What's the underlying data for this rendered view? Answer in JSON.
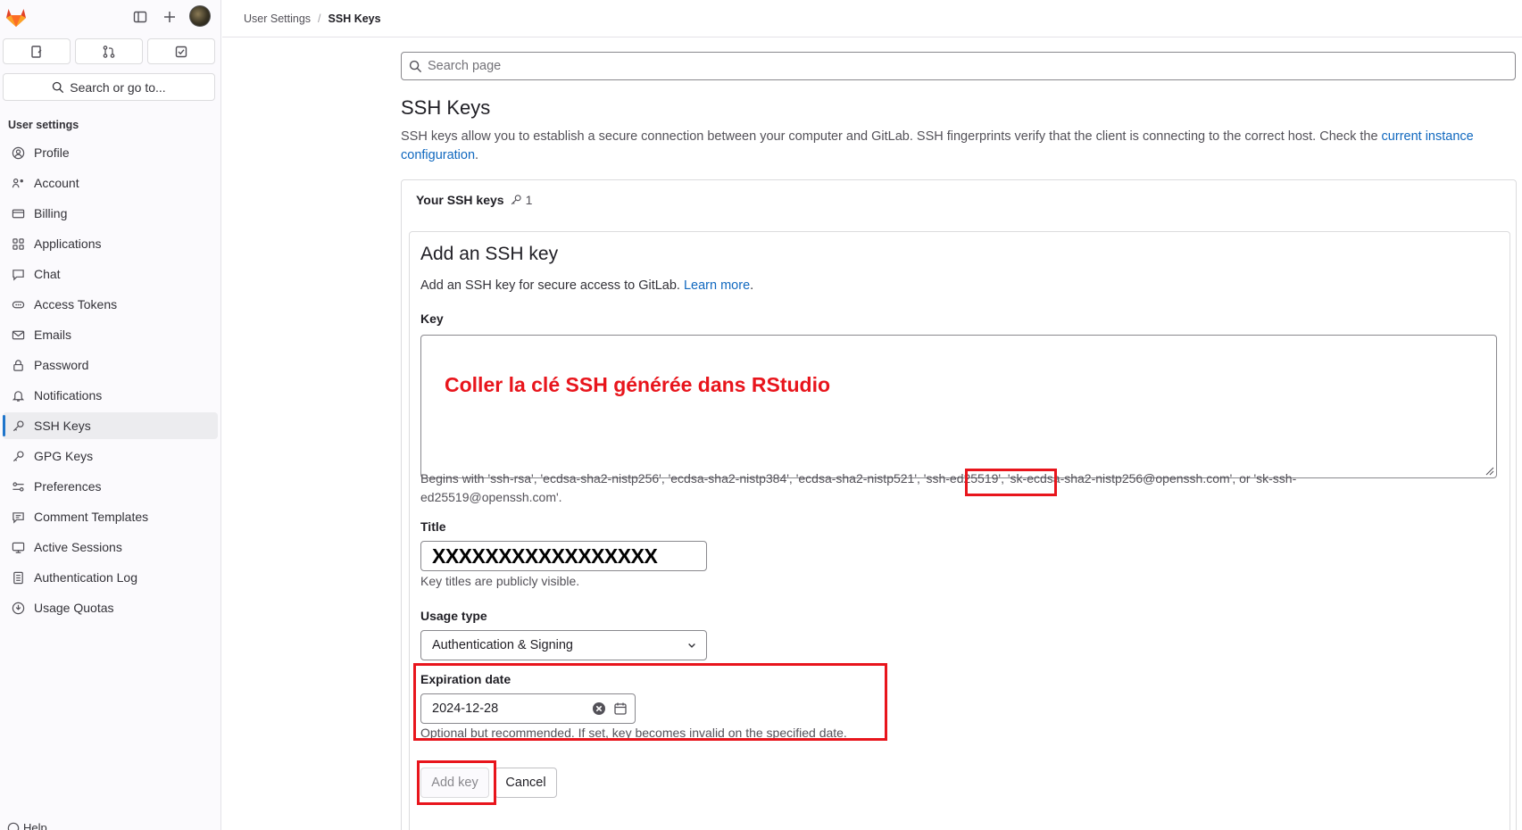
{
  "sidebar": {
    "search_label": "Search or go to...",
    "section_title": "User settings",
    "items": [
      {
        "label": "Profile",
        "icon": "profile-icon"
      },
      {
        "label": "Account",
        "icon": "account-icon"
      },
      {
        "label": "Billing",
        "icon": "billing-icon"
      },
      {
        "label": "Applications",
        "icon": "applications-icon"
      },
      {
        "label": "Chat",
        "icon": "chat-icon"
      },
      {
        "label": "Access Tokens",
        "icon": "token-icon"
      },
      {
        "label": "Emails",
        "icon": "mail-icon"
      },
      {
        "label": "Password",
        "icon": "lock-icon"
      },
      {
        "label": "Notifications",
        "icon": "bell-icon"
      },
      {
        "label": "SSH Keys",
        "icon": "key-icon",
        "active": true
      },
      {
        "label": "GPG Keys",
        "icon": "key-icon"
      },
      {
        "label": "Preferences",
        "icon": "preferences-icon"
      },
      {
        "label": "Comment Templates",
        "icon": "comment-icon"
      },
      {
        "label": "Active Sessions",
        "icon": "monitor-icon"
      },
      {
        "label": "Authentication Log",
        "icon": "log-icon"
      },
      {
        "label": "Usage Quotas",
        "icon": "quota-icon"
      }
    ],
    "help_label": "Help"
  },
  "breadcrumb": {
    "parent": "User Settings",
    "separator": "/",
    "current": "SSH Keys"
  },
  "main": {
    "search_placeholder": "Search page",
    "title": "SSH Keys",
    "description": "SSH keys allow you to establish a secure connection between your computer and GitLab. SSH fingerprints verify that the client is connecting to the correct host. Check the ",
    "description_link": "current instance configuration",
    "description_end": ".",
    "card_title": "Your SSH keys",
    "key_count": "1"
  },
  "form": {
    "title": "Add an SSH key",
    "description": "Add an SSH key for secure access to GitLab. ",
    "learn_more": "Learn more",
    "description_end": ".",
    "key_label": "Key",
    "key_overlay": "Coller la clé SSH générée dans RStudio",
    "key_help_line1": "Begins with 'ssh-rsa', 'ecdsa-sha2-nistp256', 'ecdsa-sha2-nistp384', 'ecdsa-sha2-nistp521', 'ssh-ed25519', 'sk-ecdsa-sha2-nistp256@openssh.com', or 'sk-ssh-",
    "key_help_line2": "ed25519@openssh.com'.",
    "title_label": "Title",
    "title_value": "XXXXXXXXXXXXXXXXX",
    "title_help": "Key titles are publicly visible.",
    "usage_label": "Usage type",
    "usage_value": "Authentication & Signing",
    "expiration_label": "Expiration date",
    "expiration_value": "2024-12-28",
    "expiration_help": "Optional but recommended. If set, key becomes invalid on the specified date.",
    "add_button": "Add key",
    "cancel_button": "Cancel"
  },
  "colors": {
    "annotation_red": "#e8151c",
    "link_blue": "#1068bf",
    "active_indicator": "#1f75cb"
  }
}
